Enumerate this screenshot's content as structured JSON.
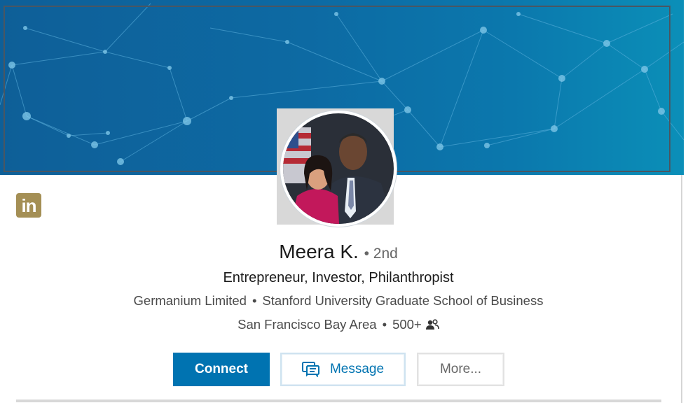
{
  "profile": {
    "name": "Meera K.",
    "degree": "• 2nd",
    "headline": "Entrepreneur, Investor, Philanthropist",
    "company": "Germanium Limited",
    "school": "Stanford University Graduate School of Business",
    "location": "San Francisco Bay Area",
    "connections": "500+",
    "separator": "•"
  },
  "logo": {
    "text": "in",
    "color": "#a48f55"
  },
  "actions": {
    "connect_label": "Connect",
    "message_label": "Message",
    "more_label": "More..."
  },
  "icons": {
    "message": "message-bubbles-icon",
    "connections": "people-icon",
    "logo": "linkedin-logo"
  },
  "colors": {
    "accent": "#0073b1",
    "banner": "#0d6aa3"
  }
}
